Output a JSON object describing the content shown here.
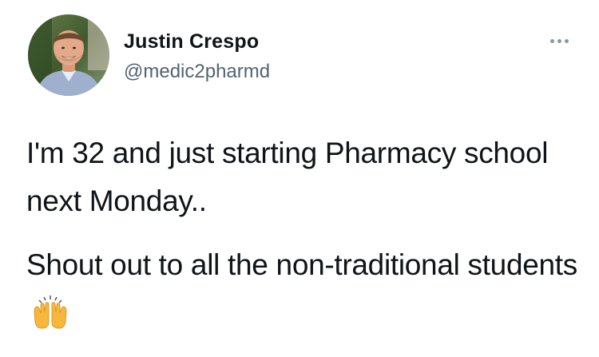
{
  "author": {
    "name": "Justin Crespo",
    "handle": "@medic2pharmd"
  },
  "tweet": {
    "paragraph_1": "I'm 32 and just starting Pharmacy school next Monday..",
    "paragraph_2": "Shout out to all the non-traditional students",
    "paragraph_2_emoji": "raising-hands-emoji"
  },
  "icons": {
    "more": "more-options-icon",
    "avatar": "profile-photo"
  },
  "colors": {
    "text": "#0f1419",
    "secondary": "#536471",
    "more_dots": "#8b98a5",
    "emoji": "#f6b73c"
  }
}
